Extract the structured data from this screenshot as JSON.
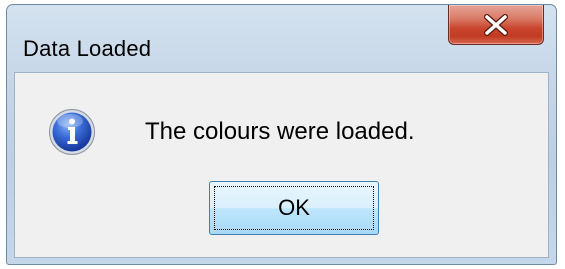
{
  "window": {
    "title": "Data Loaded"
  },
  "dialog": {
    "message": "The colours were loaded.",
    "icon": "information-icon",
    "ok_label": "OK"
  },
  "titlebar": {
    "close_icon": "close-icon",
    "close_color": "#c9462e"
  },
  "colors": {
    "frame": "#c6d6e7",
    "client_background": "#f0f0f0",
    "button_accent": "#3c7fb1",
    "info_icon_blue": "#1f4fbf"
  }
}
